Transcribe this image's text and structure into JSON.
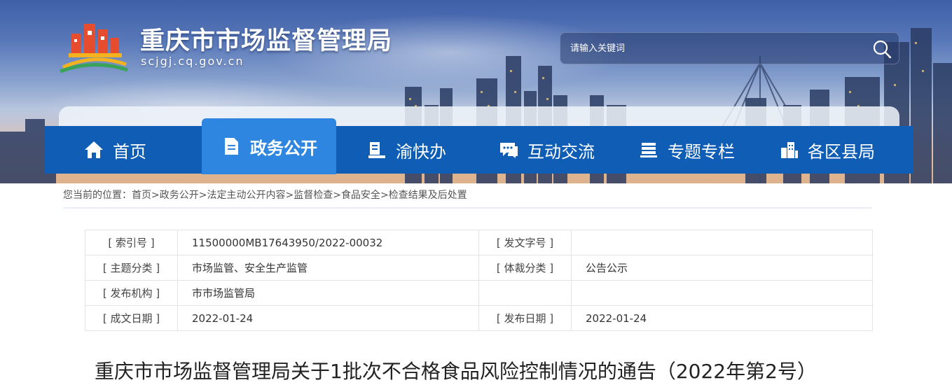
{
  "header": {
    "site_title": "重庆市市场监督管理局",
    "site_domain": "scjgj.cq.gov.cn",
    "logo_icon": "government-building-logo",
    "search": {
      "placeholder": "请输入关键词",
      "icon": "search-icon"
    }
  },
  "nav": {
    "items": [
      {
        "label": "首页",
        "icon": "home-icon",
        "active": false
      },
      {
        "label": "政务公开",
        "icon": "document-icon",
        "active": true
      },
      {
        "label": "渝快办",
        "icon": "service-desk-icon",
        "active": false
      },
      {
        "label": "互动交流",
        "icon": "chat-icon",
        "active": false
      },
      {
        "label": "专题专栏",
        "icon": "stack-icon",
        "active": false
      },
      {
        "label": "各区县局",
        "icon": "buildings-icon",
        "active": false
      }
    ]
  },
  "breadcrumb": {
    "prefix": "您当前的位置：",
    "items": [
      "首页",
      "政务公开",
      "法定主动公开内容",
      "监督检查",
      "食品安全",
      "检查结果及后处置"
    ]
  },
  "info": {
    "rows": [
      {
        "k1": "[ 索引号 ]",
        "v1": "11500000MB17643950/2022-00032",
        "k2": "[ 发文字号 ]",
        "v2": ""
      },
      {
        "k1": "[ 主题分类 ]",
        "v1": "市场监管、安全生产监管",
        "k2": "[ 体裁分类 ]",
        "v2": "公告公示"
      },
      {
        "k1": "[ 发布机构 ]",
        "v1": "市市场监管局",
        "k2": "",
        "v2": ""
      },
      {
        "k1": "[ 成文日期 ]",
        "v1": "2022-01-24",
        "k2": "[ 发布日期 ]",
        "v2": "2022-01-24"
      }
    ]
  },
  "article": {
    "title": "重庆市市场监督管理局关于1批次不合格食品风险控制情况的通告（2022年第2号）"
  },
  "colors": {
    "nav_bg": "#0f5db5",
    "nav_active": "#2f86e0"
  }
}
